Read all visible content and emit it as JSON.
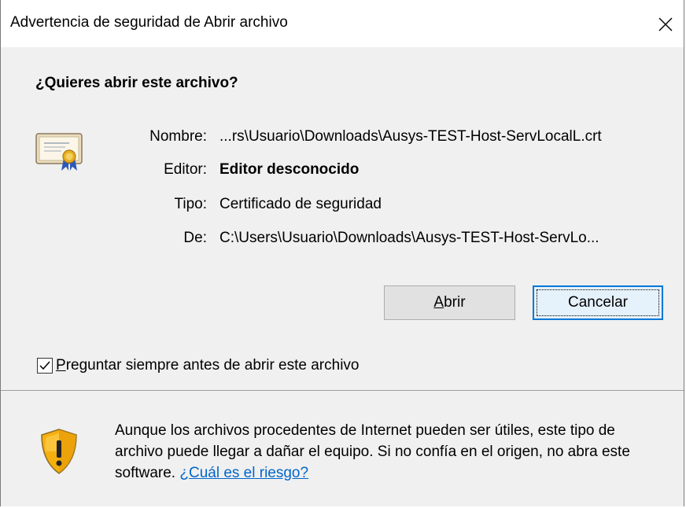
{
  "window": {
    "title": "Advertencia de seguridad de Abrir archivo",
    "close_icon": "close-icon"
  },
  "heading": "¿Quieres abrir este archivo?",
  "file_icon": "certificate-icon",
  "fields": {
    "name_label": "Nombre:",
    "name_value": "...rs\\Usuario\\Downloads\\Ausys-TEST-Host-ServLocalL.crt",
    "publisher_label": "Editor:",
    "publisher_value": "Editor desconocido",
    "type_label": "Tipo:",
    "type_value": "Certificado de seguridad",
    "from_label": "De:",
    "from_value": "C:\\Users\\Usuario\\Downloads\\Ausys-TEST-Host-ServLo..."
  },
  "buttons": {
    "open_mnemonic": "A",
    "open_rest": "brir",
    "cancel_label": "Cancelar"
  },
  "checkbox": {
    "mnemonic": "P",
    "rest": "reguntar siempre antes de abrir este archivo",
    "checked": true
  },
  "footer": {
    "shield_icon": "warning-shield-icon",
    "warning_text": "Aunque los archivos procedentes de Internet pueden ser útiles, este tipo de archivo puede llegar a dañar el equipo. Si no confía en el origen, no abra este software.",
    "risk_link": "¿Cuál es el riesgo?"
  },
  "colors": {
    "accent": "#0078d7",
    "link": "#0066cc",
    "dialog_bg": "#f0f0f0"
  }
}
